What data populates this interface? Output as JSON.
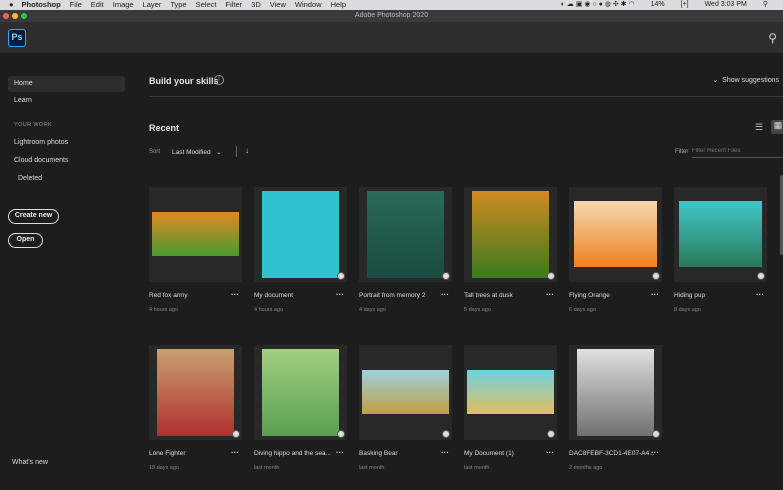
{
  "menubar": {
    "app": "Photoshop",
    "items": [
      "File",
      "Edit",
      "Image",
      "Layer",
      "Type",
      "Select",
      "Filter",
      "3D",
      "View",
      "Window",
      "Help"
    ],
    "battery": "14%",
    "clock": "Wed 3:03 PM"
  },
  "window": {
    "title": "Adobe Photoshop 2020",
    "logo": "Ps"
  },
  "sidebar": {
    "home": "Home",
    "learn": "Learn",
    "section": "YOUR WORK",
    "lightroom": "Lightroom photos",
    "cloud": "Cloud documents",
    "deleted": "Deleted",
    "create": "Create new",
    "open": "Open",
    "whats_new": "What's new"
  },
  "main": {
    "skills": "Build your skills",
    "show_suggestions": "Show suggestions",
    "recent": "Recent",
    "sort_label": "Sort",
    "sort_value": "Last Modified",
    "filter_label": "Filter",
    "filter_placeholder": "Filter Recent Files"
  },
  "files": [
    {
      "name": "Red fox army",
      "time": "4 hours ago",
      "colors": [
        "#e08a20",
        "#4a9a30"
      ]
    },
    {
      "name": "My document",
      "time": "4 hours ago",
      "colors": [
        "#2fc3d0",
        "#2fc3d0"
      ]
    },
    {
      "name": "Portrait from memory 2",
      "time": "4 days ago",
      "colors": [
        "#2a6a5a",
        "#1a4a40"
      ]
    },
    {
      "name": "Tall trees at dusk",
      "time": "5 days ago",
      "colors": [
        "#d08a20",
        "#3a7a20"
      ]
    },
    {
      "name": "Flying Orange",
      "time": "6 days ago",
      "colors": [
        "#f4d8b0",
        "#f08020"
      ]
    },
    {
      "name": "Hiding pup",
      "time": "8 days ago",
      "colors": [
        "#40c8c8",
        "#2a7a5a"
      ]
    },
    {
      "name": "Lone Fighter",
      "time": "19 days ago",
      "colors": [
        "#c8a070",
        "#b03030"
      ]
    },
    {
      "name": "Diving hippo and the sea...",
      "time": "last month",
      "colors": [
        "#a0d080",
        "#5aa050"
      ]
    },
    {
      "name": "Basking Bear",
      "time": "last month",
      "colors": [
        "#a0d0e0",
        "#c0a040"
      ]
    },
    {
      "name": "My Document (1)",
      "time": "last month",
      "colors": [
        "#70d0e0",
        "#e0c060"
      ]
    },
    {
      "name": "DAC8FEBF-3CD1-4E07-A4...",
      "time": "2 months ago",
      "colors": [
        "#e0e0e0",
        "#707070"
      ]
    }
  ]
}
